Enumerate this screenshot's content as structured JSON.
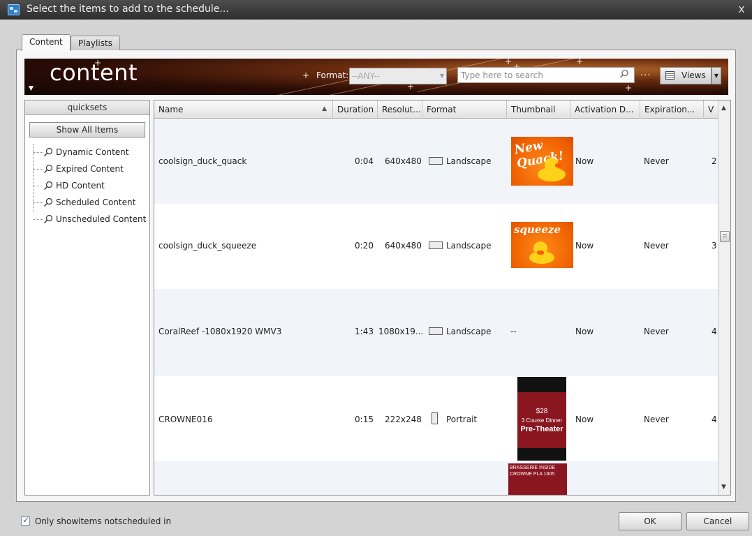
{
  "window": {
    "title": "Select the items to add to the schedule...",
    "close_glyph": "x"
  },
  "tabs": [
    {
      "label": "Content",
      "active": true
    },
    {
      "label": "Playlists",
      "active": false
    }
  ],
  "banner": {
    "title": "content",
    "format_label": "Format:",
    "format_value": "--ANY--",
    "search_placeholder": "Type here to search",
    "more_glyph": "...",
    "views_label": "Views"
  },
  "quicksets": {
    "header": "quicksets",
    "show_all_label": "Show All Items",
    "items": [
      {
        "label": "Dynamic Content"
      },
      {
        "label": "Expired Content"
      },
      {
        "label": "HD Content"
      },
      {
        "label": "Scheduled Content"
      },
      {
        "label": "Unscheduled Content"
      }
    ]
  },
  "grid": {
    "columns": [
      {
        "key": "name",
        "label": "Name",
        "sorted": "ascending"
      },
      {
        "key": "duration",
        "label": "Duration"
      },
      {
        "key": "resolution",
        "label": "Resolut..."
      },
      {
        "key": "format",
        "label": "Format"
      },
      {
        "key": "thumbnail",
        "label": "Thumbnail"
      },
      {
        "key": "activation",
        "label": "Activation D..."
      },
      {
        "key": "expiration",
        "label": "Expiration..."
      },
      {
        "key": "version",
        "label": "V"
      }
    ],
    "rows": [
      {
        "name": "coolsign_duck_quack",
        "duration": "0:04",
        "resolution": "640x480",
        "format": "Landscape",
        "thumbnail": "duck-quack",
        "thumb_text": "New Quack!",
        "activation": "Now",
        "expiration": "Never",
        "version": "2"
      },
      {
        "name": "coolsign_duck_squeeze",
        "duration": "0:20",
        "resolution": "640x480",
        "format": "Landscape",
        "thumbnail": "duck-squeeze",
        "thumb_text": "squeeze",
        "activation": "Now",
        "expiration": "Never",
        "version": "3"
      },
      {
        "name": "CoralReef -1080x1920 WMV3",
        "duration": "1:43",
        "resolution": "1080x19...",
        "format": "Landscape",
        "thumbnail": "--",
        "activation": "Now",
        "expiration": "Never",
        "version": "4"
      },
      {
        "name": "CROWNE016",
        "duration": "0:15",
        "resolution": "222x248",
        "format": "Portrait",
        "thumbnail": "crowne-dinner",
        "thumb_price": "$28",
        "thumb_line1": "3 Course Dinner",
        "thumb_line2": "Pre-Theater",
        "activation": "Now",
        "expiration": "Never",
        "version": "4"
      }
    ],
    "partial_thumb_text": "BRASSERIE INSIDE CROWNE PLA 1605"
  },
  "footer": {
    "only_show_label": "Only showitems notscheduled in",
    "only_show_checked": true,
    "ok_label": "OK",
    "cancel_label": "Cancel"
  },
  "colors": {
    "banner_dark": "#120504",
    "banner_glow": "#b86a2a",
    "duck_orange": "#f06000",
    "duck_yellow": "#ffd21a",
    "crowne_red": "#8a1620"
  }
}
